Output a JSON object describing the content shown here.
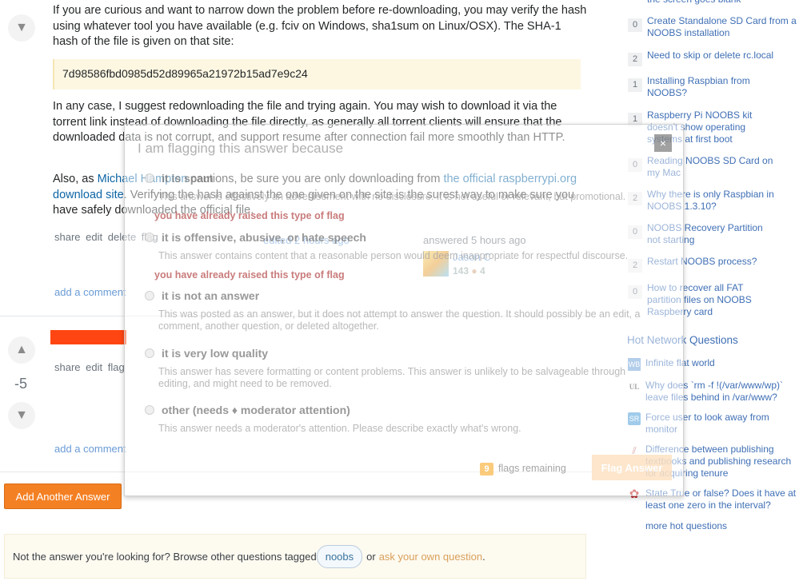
{
  "answer1": {
    "para1": "If you are curious and want to narrow down the problem before re-downloading, you may verify the hash using whatever tool you have available (e.g. fciv on Windows, sha1sum on Linux/OSX). The SHA-1 hash of the file is given on that site:",
    "hash": "7d98586fbd0985d52d89965a21972b15ad7e9c24",
    "para2": "In any case, I suggest redownloading the file and trying again. You may wish to download it via the torrent link instead of downloading the file directly, as generally all torrent clients will ensure that the downloaded data is not corrupt, and support resume after connection fail more smoothly than HTTP.",
    "para3_pre": "Also, as ",
    "para3_link1": "Michael Hampton",
    "para3_mid": " cautions, be sure you are only downloading from ",
    "para3_link2": "the official raspberrypi.org download site",
    "para3_post": ". Verifying the hash against the one given on the site is the surest way to make sure you have safely downloaded the official file.",
    "menu": [
      "share",
      "edit",
      "delete",
      "flag"
    ],
    "edited": "edited 2 hours ago",
    "answered": "answered 5 hours ago",
    "user": "Jason C",
    "rep": "143",
    "bronze": "4",
    "add_comment": "add a comment"
  },
  "answer2": {
    "score": "-5",
    "menu": [
      "share",
      "edit",
      "flag"
    ],
    "add_comment": "add a comment"
  },
  "add_answer_button": "Add Another Answer",
  "footer": {
    "pre": "Not the answer you're looking for? Browse other questions tagged ",
    "tag": "noobs",
    "mid": " or ",
    "link": "ask your own question",
    "post": "."
  },
  "sidebar": {
    "top_cut": "the screen goes blank",
    "linked": [
      {
        "count": "0",
        "title": "Create Standalone SD Card from a NOOBS installation"
      },
      {
        "count": "2",
        "title": "Need to skip or delete rc.local"
      },
      {
        "count": "1",
        "title": "Installing Raspbian from NOOBS?"
      },
      {
        "count": "1",
        "title": "Raspberry Pi NOOBS kit doesn't show operating systems at first boot"
      },
      {
        "count": "0",
        "title": "Reading NOOBS SD Card on my Mac"
      },
      {
        "count": "2",
        "title": "Why there is only Raspbian in NOOBS 1.3.10?"
      },
      {
        "count": "0",
        "title": "NOOBS Recovery Partition not starting"
      },
      {
        "count": "2",
        "title": "Restart NOOBS process?"
      },
      {
        "count": "0",
        "title": "How to recover all FAT partition files on NOOBS Raspberry card"
      }
    ],
    "hot_title": "Hot Network Questions",
    "hot": [
      {
        "icon": "WB",
        "title": "Infinite flat world"
      },
      {
        "icon": "UL",
        "title": "Why does `rm -f !(/var/www/wp)` leave files behind in /var/www?"
      },
      {
        "icon": "SR",
        "title": "Force user to look away from monitor"
      },
      {
        "icon": "AC",
        "title": "Difference between publishing textbooks and publishing research for acquiring tenure"
      },
      {
        "icon": "MA",
        "title": "State True or false? Does it have at least one zero in the interval?"
      }
    ],
    "more": "more hot questions"
  },
  "modal": {
    "title": "I am flagging this answer because",
    "close": "×",
    "warning": "you have already raised this type of flag",
    "options": [
      {
        "label": "it is spam",
        "desc": "This answer is effectively an advertisement with no disclosure. It is not useful or relevant, but promotional."
      },
      {
        "label": "it is offensive, abusive, or hate speech",
        "desc": "This answer contains content that a reasonable person would deem inappropriate for respectful discourse."
      },
      {
        "label": "it is not an answer",
        "desc": "This was posted as an answer, but it does not attempt to answer the question. It should possibly be an edit, a comment, another question, or deleted altogether."
      },
      {
        "label": "it is very low quality",
        "desc": "This answer has severe formatting or content problems. This answer is unlikely to be salvageable through editing, and might need to be removed."
      },
      {
        "label": "other (needs ♦ moderator attention)",
        "desc": "This answer needs a moderator's attention. Please describe exactly what's wrong."
      }
    ],
    "flags_count": "9",
    "flags_label": "flags remaining",
    "submit": "Flag Answer"
  }
}
